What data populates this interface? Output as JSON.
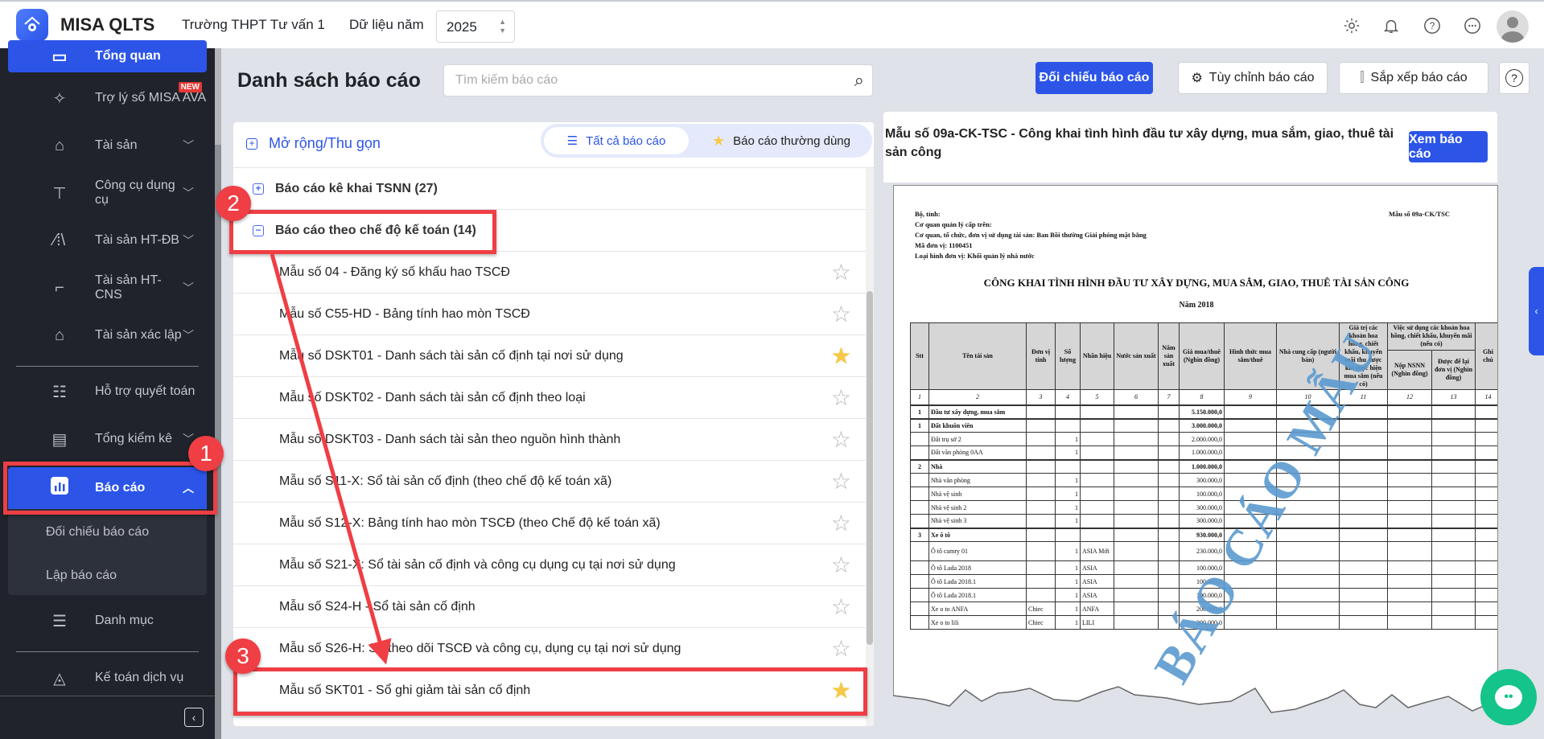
{
  "header": {
    "app_name": "MISA QLTS",
    "school": "Trường THPT Tư vấn 1",
    "year_label": "Dữ liệu năm",
    "year_value": "2025"
  },
  "sidebar": {
    "items": [
      {
        "label": "Tổng quan"
      },
      {
        "label": "Trợ lý số MISA AVA",
        "badge": "NEW"
      },
      {
        "label": "Tài sản"
      },
      {
        "label": "Công cụ dụng cụ"
      },
      {
        "label": "Tài sản HT-ĐB"
      },
      {
        "label": "Tài sản HT-CNS"
      },
      {
        "label": "Tài sản xác lập"
      },
      {
        "label": "Hỗ trợ quyết toán"
      },
      {
        "label": "Tổng kiểm kê"
      },
      {
        "label": "Báo cáo"
      },
      {
        "label": "Danh mục"
      },
      {
        "label": "Kế toán dịch vụ"
      }
    ],
    "sub_items": [
      {
        "label": "Đối chiếu báo cáo"
      },
      {
        "label": "Lập báo cáo"
      }
    ]
  },
  "main": {
    "title": "Danh sách báo cáo",
    "search_placeholder": "Tìm kiếm báo cáo",
    "buttons": {
      "compare": "Đối chiếu báo cáo",
      "customize": "Tùy chỉnh báo cáo",
      "sort": "Sắp xếp báo cáo"
    },
    "expand_label": "Mở rộng/Thu gọn",
    "tabs": {
      "all": "Tất cả báo cáo",
      "frequent": "Báo cáo thường dùng"
    },
    "groups": [
      {
        "label": "Báo cáo kê khai TSNN (27)",
        "expanded": false
      },
      {
        "label": "Báo cáo theo chế độ kế toán (14)",
        "expanded": true
      }
    ],
    "reports": [
      {
        "label": "Mẫu số 04 - Đăng ký số khấu hao TSCĐ",
        "favorite": false
      },
      {
        "label": "Mẫu số C55-HD - Bảng tính hao mòn TSCĐ",
        "favorite": false
      },
      {
        "label": "Mẫu số DSKT01 - Danh sách tài sản cố định tại nơi sử dụng",
        "favorite": true
      },
      {
        "label": "Mẫu số DSKT02 - Danh sách tài sản cố định theo loại",
        "favorite": false
      },
      {
        "label": "Mẫu số DSKT03 - Danh sách tài sản theo nguồn hình thành",
        "favorite": false
      },
      {
        "label": "Mẫu số S11-X: Sổ tài sản cố định (theo chế độ kế toán xã)",
        "favorite": false
      },
      {
        "label": "Mẫu số S12-X: Bảng tính hao mòn TSCĐ (theo Chế độ kế toán xã)",
        "favorite": false
      },
      {
        "label": "Mẫu số S21-X: Sổ tài sản cố định và công cụ dụng cụ tại nơi sử dụng",
        "favorite": false
      },
      {
        "label": "Mẫu số S24-H - Sổ tài sản cố định",
        "favorite": false
      },
      {
        "label": "Mẫu số S26-H: Sổ theo dõi TSCĐ và công cụ, dụng cụ tại nơi sử dụng",
        "favorite": false
      },
      {
        "label": "Mẫu số SKT01 - Sổ ghi giảm tài sản cố định",
        "favorite": true
      }
    ]
  },
  "preview": {
    "title": "Mẫu số 09a-CK-TSC - Công khai tình hình đầu tư xây dựng, mua sắm, giao, thuê tài sản công",
    "view_button": "Xem báo cáo",
    "doc": {
      "form_code": "Mẫu số 09a-CK/TSC",
      "meta": [
        "Bộ, tỉnh:",
        "Cơ quan quản lý cấp trên:",
        "Cơ quan, tổ chức, đơn vị sử dụng tài sản: Ban Bồi thường Giải phóng mặt bằng",
        "Mã đơn vị: 1100451",
        "Loại hình đơn vị: Khối quản lý nhà nước"
      ],
      "title": "CÔNG KHAI TÌNH HÌNH ĐẦU TƯ XÂY DỰNG, MUA SẮM, GIAO, THUÊ TÀI SẢN CÔNG",
      "year": "Năm 2018",
      "watermark": "BÁO CÁO MẪU",
      "headers": [
        "Stt",
        "Tên tài sản",
        "Đơn vị tính",
        "Số lượng",
        "Nhãn hiệu",
        "Nước sản xuất",
        "Năm sản xuất",
        "Giá mua/thuê (Nghìn đồng)",
        "Hình thức mua sắm/thuê",
        "Nhà cung cấp (người bán)",
        "Giá trị các khoản hoa hồng, chiết khấu, khuyến mãi thu được khi thực hiện mua sắm (nếu có)",
        "Việc sử dụng các khoản hoa hồng, chiết khấu, khuyến mãi (nếu có)",
        "Ghi chú"
      ],
      "subheaders": [
        "Nộp NSNN (Nghìn đồng)",
        "Được để lại đơn vị (Nghìn đồng)"
      ],
      "col_numbers": [
        "1",
        "2",
        "3",
        "4",
        "5",
        "6",
        "7",
        "8",
        "9",
        "10",
        "11",
        "12",
        "13",
        "14"
      ],
      "rows": [
        {
          "stt": "1",
          "name": "Đầu tư xây dựng, mua sắm",
          "unit": "",
          "qty": "",
          "brand": "",
          "price": "5.150.000,0",
          "bold": true
        },
        {
          "stt": "1",
          "name": "Đất khuôn viên",
          "unit": "",
          "qty": "",
          "brand": "",
          "price": "3.000.000,0",
          "bold": true
        },
        {
          "stt": "",
          "name": "Đất trụ sở 2",
          "unit": "",
          "qty": "1",
          "brand": "",
          "price": "2.000.000,0"
        },
        {
          "stt": "",
          "name": "Đất văn phòng 0AA",
          "unit": "",
          "qty": "1",
          "brand": "",
          "price": "1.000.000,0"
        },
        {
          "stt": "2",
          "name": "Nhà",
          "unit": "",
          "qty": "",
          "brand": "",
          "price": "1.000.000,0",
          "bold": true
        },
        {
          "stt": "",
          "name": "Nhà văn phòng",
          "unit": "",
          "qty": "1",
          "brand": "",
          "price": "300.000,0"
        },
        {
          "stt": "",
          "name": "Nhà vệ sinh",
          "unit": "",
          "qty": "1",
          "brand": "",
          "price": "100.000,0"
        },
        {
          "stt": "",
          "name": "Nhà vệ sinh 2",
          "unit": "",
          "qty": "1",
          "brand": "",
          "price": "300.000,0"
        },
        {
          "stt": "",
          "name": "Nhà vệ sinh 3",
          "unit": "",
          "qty": "1",
          "brand": "",
          "price": "300.000,0"
        },
        {
          "stt": "3",
          "name": "Xe ô tô",
          "unit": "",
          "qty": "",
          "brand": "",
          "price": "930.000,0",
          "bold": true
        },
        {
          "stt": "",
          "name": "Ô tô camry 01",
          "unit": "",
          "qty": "1",
          "brand": "ASIA Mới",
          "price": "230.000,0"
        },
        {
          "stt": "",
          "name": "Ô tô Lada 2018",
          "unit": "",
          "qty": "1",
          "brand": "ASIA",
          "price": "100.000,0"
        },
        {
          "stt": "",
          "name": "Ô tô Lada 2018.1",
          "unit": "",
          "qty": "1",
          "brand": "ASIA",
          "price": "100.000,0"
        },
        {
          "stt": "",
          "name": "Ô tô Lada 2018.1",
          "unit": "",
          "qty": "1",
          "brand": "ASIA",
          "price": "100.000,0"
        },
        {
          "stt": "",
          "name": "Xe o to ANFA",
          "unit": "Chiec",
          "qty": "1",
          "brand": "ANFA",
          "price": "200.000,0"
        },
        {
          "stt": "",
          "name": "Xe o to lili",
          "unit": "Chiec",
          "qty": "1",
          "brand": "LILI",
          "price": "200.000,0"
        }
      ]
    }
  },
  "annotations": [
    "1",
    "2",
    "3"
  ],
  "colors": {
    "primary": "#2c55e8",
    "sidebar": "#20232b",
    "highlight": "#ef3e44",
    "star": "#f7c948",
    "watermark": "#5b9bd0"
  }
}
